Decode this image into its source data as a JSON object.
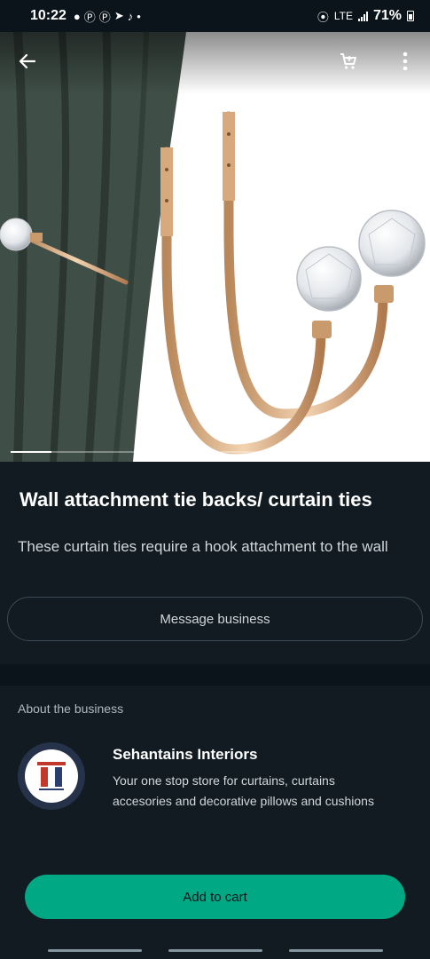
{
  "status_bar": {
    "time": "10:22",
    "network": "LTE",
    "battery": "71%"
  },
  "product": {
    "image_alt": "Gold curtain tie-back hooks with crystal ball ends",
    "image_progress": 0.1,
    "title": "Wall attachment tie backs/ curtain ties",
    "description": "These curtain ties require a hook attachment to the wall",
    "message_button": "Message business"
  },
  "about": {
    "label": "About the business",
    "business_name": "Sehantains Interiors",
    "business_desc_line1": "Your one stop store for curtains, curtains",
    "business_desc_line2": "accesories and decorative pillows and cushions"
  },
  "cart": {
    "add_label": "Add to cart"
  },
  "icons": {
    "back": "arrow-left-icon",
    "cart": "cart-icon",
    "more": "more-vert-icon"
  },
  "colors": {
    "background": "#111b21",
    "accent": "#00a884",
    "text": "#e9edef"
  }
}
